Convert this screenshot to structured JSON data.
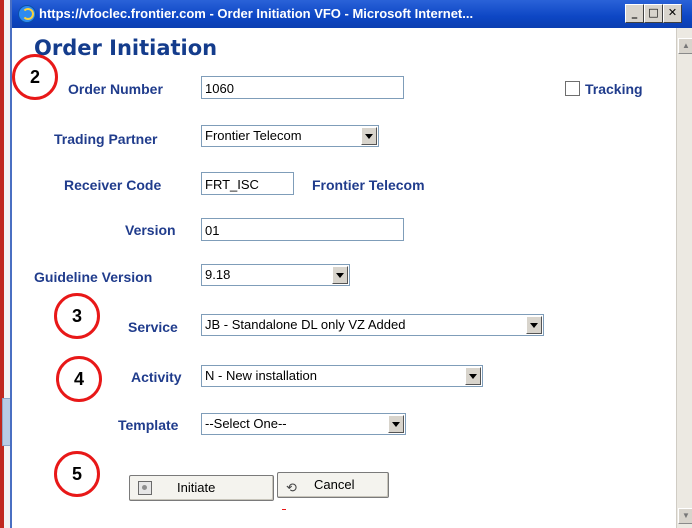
{
  "window": {
    "title": "https://vfoclec.frontier.com - Order Initiation VFO - Microsoft Internet...",
    "minimize": "_",
    "maximize": "□",
    "close": "✕"
  },
  "page": {
    "heading": "Order Initiation"
  },
  "form": {
    "order_number_label": "Order Number",
    "order_number_value": "1060",
    "tracking_label": "Tracking",
    "trading_partner_label": "Trading Partner",
    "trading_partner_value": "Frontier Telecom",
    "receiver_code_label": "Receiver Code",
    "receiver_code_value": "FRT_ISC",
    "receiver_name": "Frontier Telecom",
    "version_label": "Version",
    "version_value": "01",
    "guideline_version_label": "Guideline Version",
    "guideline_version_value": "9.18",
    "service_label": "Service",
    "service_value": "JB - Standalone DL only VZ Added",
    "activity_label": "Activity",
    "activity_value": "N - New installation",
    "template_label": "Template",
    "template_value": "--Select One--"
  },
  "buttons": {
    "initiate": "Initiate",
    "cancel": "Cancel"
  },
  "callouts": [
    "2",
    "3",
    "4",
    "5"
  ],
  "colors": {
    "label": "#203c8c",
    "callout": "#e81818",
    "titlebar": "#0d46c4"
  }
}
